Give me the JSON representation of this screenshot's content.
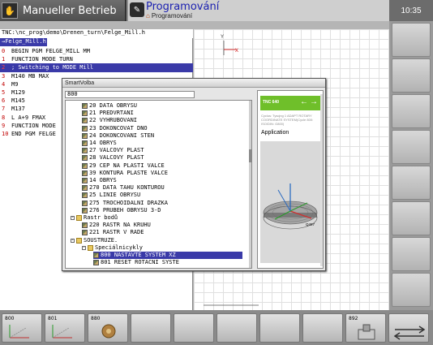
{
  "header": {
    "left_mode": "Manueller Betrieb",
    "mid_mode": "Programování",
    "mid_sub": "Programování",
    "clock": "10:35"
  },
  "program": {
    "path": "TNC:\\nc_prog\\demo\\Drenen_turn\\Felge_Mill.h",
    "tab": "Felge_Mill.h",
    "lines": [
      {
        "num": "0",
        "text": "BEGIN PGM FELGE_MILL MM"
      },
      {
        "num": "1",
        "text": "FUNCTION MODE TURN"
      },
      {
        "num": "2",
        "text": "; Switching to MODE Mill"
      },
      {
        "num": "3",
        "text": "M140 MB MAX"
      },
      {
        "num": "4",
        "text": "M9"
      },
      {
        "num": "5",
        "text": "M129"
      },
      {
        "num": "6",
        "text": "M145"
      },
      {
        "num": "7",
        "text": "M137"
      },
      {
        "num": "8",
        "text": "L  A+9 FMAX"
      },
      {
        "num": "9",
        "text": "FUNCTION MODE"
      },
      {
        "num": "10",
        "text": "END PGM FELGE"
      }
    ]
  },
  "dialog": {
    "title": "SmartVolba",
    "search": "800",
    "tree": [
      {
        "label": "20 DATA OBRYSU",
        "icon": "cyc",
        "indent": 1
      },
      {
        "label": "21 PREDVRTANI",
        "icon": "cyc",
        "indent": 1
      },
      {
        "label": "22 VYHRUBOVANI",
        "icon": "cyc",
        "indent": 1
      },
      {
        "label": "23 DOKONCOVAT DNO",
        "icon": "cyc",
        "indent": 1
      },
      {
        "label": "24 DOKONCOVANI STEN",
        "icon": "cyc",
        "indent": 1
      },
      {
        "label": "14 OBRYS",
        "icon": "cyc",
        "indent": 1
      },
      {
        "label": "27 VALCOVY PLAST",
        "icon": "cyc",
        "indent": 1
      },
      {
        "label": "28 VALCOVY PLAST",
        "icon": "cyc",
        "indent": 1
      },
      {
        "label": "29 CEP NA PLASTI VALCE",
        "icon": "cyc",
        "indent": 1
      },
      {
        "label": "39 KONTURA PLASTE VALCE",
        "icon": "cyc",
        "indent": 1
      },
      {
        "label": "14 OBRYS",
        "icon": "cyc",
        "indent": 1
      },
      {
        "label": "270 DATA TAHU KONTUROU",
        "icon": "cyc",
        "indent": 1
      },
      {
        "label": "25 LINIE OBRYSU",
        "icon": "cyc",
        "indent": 1
      },
      {
        "label": "275 TROCHOIDALNI DRAZKA",
        "icon": "cyc",
        "indent": 1
      },
      {
        "label": "276 PRUBEH OBRYSU 3-D",
        "icon": "cyc",
        "indent": 1
      },
      {
        "label": "Rastr bodů",
        "icon": "folder",
        "indent": 0
      },
      {
        "label": "220 RASTR NA KRUHU",
        "icon": "cyc",
        "indent": 1
      },
      {
        "label": "221 RASTR V RADE",
        "icon": "cyc",
        "indent": 1
      },
      {
        "label": "SOUSTRUZE.",
        "icon": "folder",
        "indent": 0
      },
      {
        "label": "Speciálnicykly",
        "icon": "folder",
        "indent": 1
      },
      {
        "label": "800 NASTAVTE SYSTEM XZ",
        "icon": "cyc",
        "indent": 2,
        "selected": true
      },
      {
        "label": "801 RESET ROTACNI SYSTE",
        "icon": "cyc",
        "indent": 2
      }
    ],
    "help": {
      "head": "TNC 640",
      "desc": "Cyclus: Tyscjng 1 ADAPT ROTARY COORDINATE SYSTEM(Cycle 800: ISO/DIN: G800)",
      "app": "Application",
      "img_label": "Q497"
    }
  },
  "softkeys": {
    "bottom": [
      "800",
      "801",
      "880",
      "",
      "",
      "",
      "",
      "",
      "892",
      ""
    ],
    "bottom_extra": ""
  },
  "axis_labels": {
    "x": "X",
    "y": "Y",
    "z": "Z"
  }
}
